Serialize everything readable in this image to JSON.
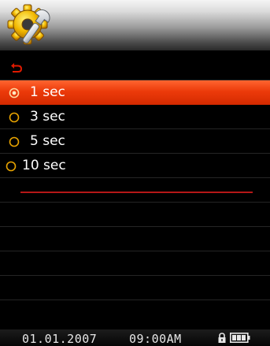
{
  "header": {
    "icon": "gear-wrench-settings-icon"
  },
  "back_row": {
    "icon": "return-arrow-icon"
  },
  "options": [
    {
      "label": "1 sec",
      "selected": true
    },
    {
      "label": "3 sec",
      "selected": false
    },
    {
      "label": "5 sec",
      "selected": false
    },
    {
      "label": "10 sec",
      "selected": false
    }
  ],
  "status_bar": {
    "date": "01.01.2007",
    "time": "09:00AM",
    "lock_icon": "lock-icon",
    "battery_icon": "battery-icon"
  },
  "colors": {
    "selection": "#ec3a0a",
    "accent_red": "#e01a00",
    "radio_unselected": "#e8a300",
    "divider": "#b51717",
    "background": "#000000"
  }
}
